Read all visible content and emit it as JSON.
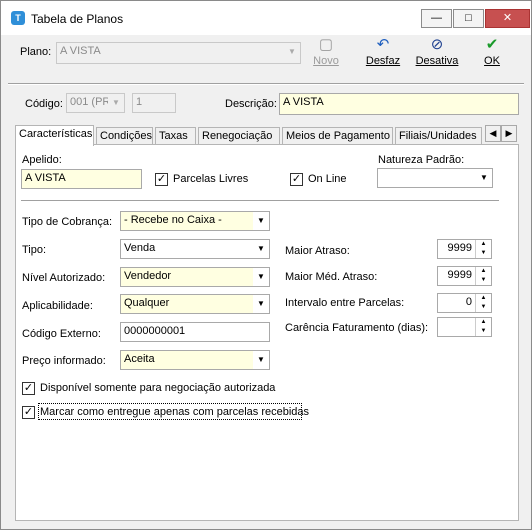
{
  "window": {
    "title": "Tabela de Planos"
  },
  "titlebar_buttons": {
    "minimize": "—",
    "maximize": "□",
    "close": "✕"
  },
  "header": {
    "plano_label": "Plano:",
    "plano_value": "A VISTA",
    "toolbar": [
      {
        "id": "novo",
        "label": "Novo",
        "icon": "new-record-icon",
        "glyph": "▢",
        "enabled": false
      },
      {
        "id": "desfaz",
        "label": "Desfaz",
        "icon": "undo-icon",
        "glyph": "↶",
        "enabled": true
      },
      {
        "id": "desativa",
        "label": "Desativa",
        "icon": "disable-icon",
        "glyph": "⊘",
        "enabled": true
      },
      {
        "id": "ok",
        "label": "OK",
        "icon": "checkmark-icon",
        "glyph": "✔",
        "enabled": true
      }
    ]
  },
  "codigo": {
    "label": "Código:",
    "value1": "001 (PR",
    "value2": "1"
  },
  "descricao": {
    "label": "Descrição:",
    "value": "A VISTA"
  },
  "tabs": [
    "Características",
    "Condições",
    "Taxas",
    "Renegociação",
    "Meios de Pagamento",
    "Filiais/Unidades"
  ],
  "active_tab": 0,
  "caracteristicas": {
    "apelido_label": "Apelido:",
    "apelido_value": "A VISTA",
    "parcelas_livres_label": "Parcelas Livres",
    "parcelas_livres_checked": true,
    "online_label": "On Line",
    "online_checked": true,
    "natureza_label": "Natureza Padrão:",
    "natureza_value": "",
    "tipo_cobranca_label": "Tipo de Cobrança:",
    "tipo_cobranca_value": "- Recebe no Caixa -",
    "tipo_label": "Tipo:",
    "tipo_value": "Venda",
    "nivel_label": "Nível Autorizado:",
    "nivel_value": "Vendedor",
    "aplicabilidade_label": "Aplicabilidade:",
    "aplicabilidade_value": "Qualquer",
    "codigo_externo_label": "Código Externo:",
    "codigo_externo_value": "0000000001",
    "preco_label": "Preço informado:",
    "preco_value": "Aceita",
    "maior_atraso_label": "Maior Atraso:",
    "maior_atraso_value": "9999",
    "maior_med_atraso_label": "Maior Méd. Atraso:",
    "maior_med_atraso_value": "9999",
    "intervalo_label": "Intervalo entre Parcelas:",
    "intervalo_value": "0",
    "carencia_label": "Carência Faturamento (dias):",
    "carencia_value": "",
    "disponivel_label": "Disponível somente para negociação autorizada",
    "disponivel_checked": true,
    "marcar_label": "Marcar como entregue apenas com parcelas recebidas",
    "marcar_checked": true
  },
  "colors": {
    "highlight_field": "#ffffe1",
    "panel": "#ffffff",
    "window": "#f0f0f0"
  }
}
